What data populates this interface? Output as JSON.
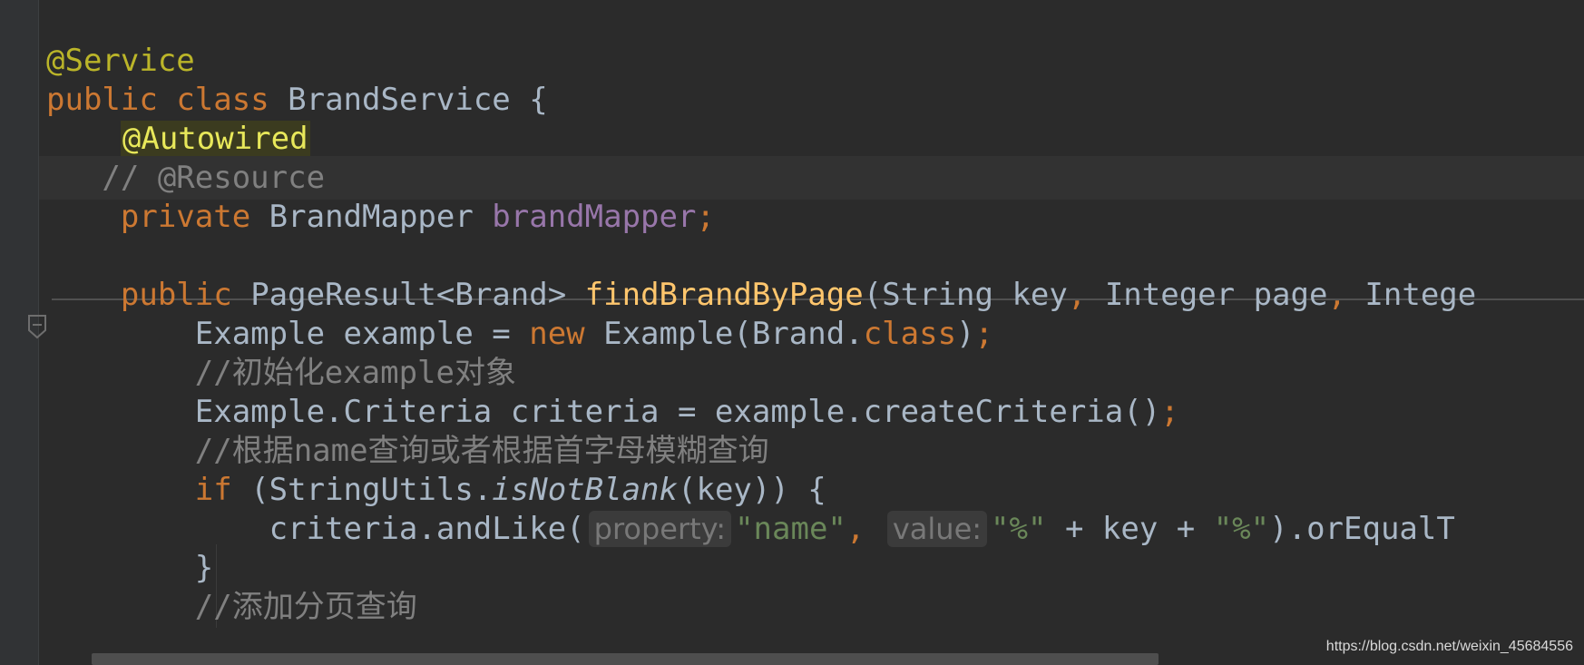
{
  "editor": {
    "lines": {
      "l1": {
        "t1": "@Service"
      },
      "l2": {
        "t1": "public",
        "t2": " ",
        "t3": "class",
        "t4": " BrandService {"
      },
      "l3": {
        "t1": "    ",
        "t2": "@Autowired"
      },
      "l4": {
        "t1": "   // @Resource"
      },
      "l5": {
        "t1": "    ",
        "t2": "private",
        "t3": " BrandMapper ",
        "t4": "brandMapper",
        "t5": ";"
      },
      "l7": {
        "t1": "    ",
        "t2": "public",
        "t3": " PageResult<Brand> ",
        "t4": "findBrandByPage",
        "t5": "(String key",
        "t6": ",",
        "t7": " Integer page",
        "t8": ",",
        "t9": " Intege"
      },
      "l8": {
        "t1": "        Example example = ",
        "t2": "new",
        "t3": " Example(Brand.",
        "t4": "class",
        "t5": ")",
        "t6": ";"
      },
      "l9": {
        "t1": "        //初始化example对象"
      },
      "l10": {
        "t1": "        Example.Criteria criteria = example.createCriteria()",
        "t2": ";"
      },
      "l11": {
        "t1": "        //根据name查询或者根据首字母模糊查询"
      },
      "l12": {
        "t1": "        ",
        "t2": "if",
        "t3": " (StringUtils.",
        "t4": "isNotBlank",
        "t5": "(key)) {"
      },
      "l13": {
        "t1": "            criteria.andLike(",
        "h1": "property:",
        "t2": "\"name\"",
        "t3": ",",
        "t4": " ",
        "h2": "value:",
        "t5": "\"%\"",
        "t6": " + key + ",
        "t7": "\"%\"",
        "t8": ").orEqualT"
      },
      "l14": {
        "t1": "        }"
      },
      "l15": {
        "t1": "        //添加分页查询"
      }
    }
  },
  "watermark": "https://blog.csdn.net/weixin_45684556",
  "colors": {
    "background": "#2b2b2b",
    "keyword": "#cc7832",
    "annotation": "#bbb529",
    "field": "#9876aa",
    "method": "#ffc66d",
    "string": "#6a8759",
    "comment": "#808080",
    "text": "#a9b7c6"
  }
}
